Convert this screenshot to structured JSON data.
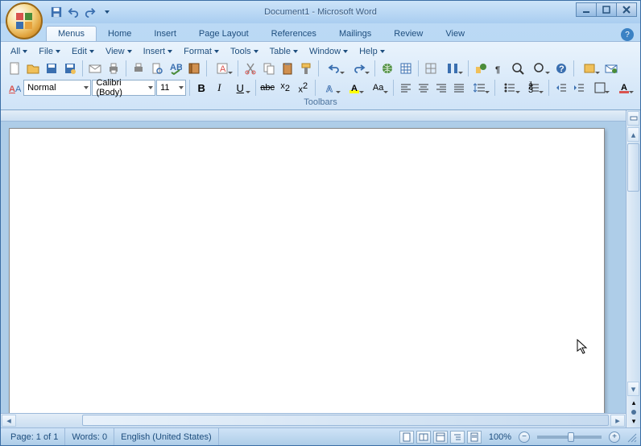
{
  "titlebar": {
    "title": "Document1 - Microsoft Word"
  },
  "tabs": {
    "items": [
      "Menus",
      "Home",
      "Insert",
      "Page Layout",
      "References",
      "Mailings",
      "Review",
      "View"
    ],
    "active": 0
  },
  "menubar": {
    "items": [
      "All",
      "File",
      "Edit",
      "View",
      "Insert",
      "Format",
      "Tools",
      "Table",
      "Window",
      "Help"
    ]
  },
  "formatting": {
    "style_label": "Normal",
    "font_label": "Calibri (Body)",
    "size_label": "11"
  },
  "toolbars_label": "Toolbars",
  "statusbar": {
    "page": "Page: 1 of 1",
    "words": "Words: 0",
    "language": "English (United States)",
    "zoom": "100%"
  },
  "icons": {
    "new": "new-icon",
    "open": "open-icon",
    "save": "save-icon",
    "mail": "mail-icon",
    "print": "print-icon",
    "preview": "preview-icon",
    "spell": "spell-icon",
    "research": "research-icon",
    "cut": "cut-icon",
    "copy": "copy-icon",
    "paste": "paste-icon",
    "fmt": "format-painter-icon",
    "undo": "undo-icon",
    "redo": "redo-icon",
    "link": "hyperlink-icon",
    "table": "table-icon",
    "cols": "columns-icon",
    "para": "show-hide-icon",
    "zoom": "zoom-icon",
    "help": "help-icon",
    "bold": "bold-icon",
    "italic": "italic-icon",
    "underline": "underline-icon",
    "strike": "strikethrough-icon",
    "sub": "subscript-icon",
    "sup": "superscript-icon",
    "align_l": "align-left-icon",
    "align_c": "align-center-icon",
    "align_r": "align-right-icon",
    "align_j": "justify-icon",
    "line_sp": "line-spacing-icon",
    "bullets": "bullets-icon",
    "numbers": "numbering-icon",
    "out_l": "decrease-indent-icon",
    "out_r": "increase-indent-icon",
    "border": "border-icon",
    "highlight": "highlight-icon",
    "fontcolor": "font-color-icon",
    "grow": "grow-font-icon",
    "shrink": "shrink-font-icon",
    "changecase": "change-case-icon",
    "clear": "clear-format-icon"
  }
}
